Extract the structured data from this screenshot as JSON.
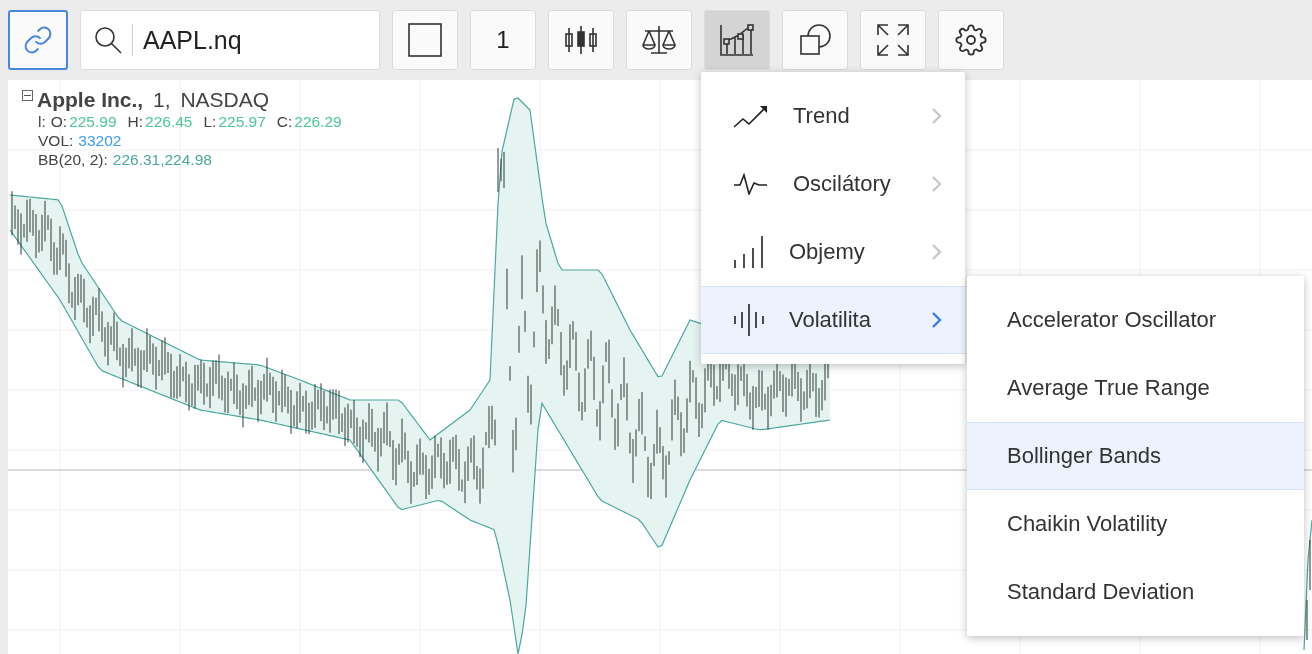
{
  "toolbar": {
    "link_button": {
      "selected": true
    },
    "search": {
      "value": "AAPL.nq"
    },
    "buttons": [
      {
        "kind": "box",
        "selected": false
      },
      {
        "kind": "text",
        "label": "1",
        "selected": false
      },
      {
        "kind": "candles",
        "selected": false
      },
      {
        "kind": "balance",
        "selected": false
      },
      {
        "kind": "indicators",
        "selected": true
      },
      {
        "kind": "shapes",
        "selected": false
      },
      {
        "kind": "fullscreen",
        "selected": false
      },
      {
        "kind": "settings",
        "selected": false
      }
    ]
  },
  "legend": {
    "symbol": "Apple Inc.,",
    "interval": "1,",
    "exchange": "NASDAQ",
    "ohlc_prefix": "l:",
    "ohlc": [
      {
        "label": "O:",
        "value": "225.99"
      },
      {
        "label": "H:",
        "value": "226.45"
      },
      {
        "label": "L:",
        "value": "225.97"
      },
      {
        "label": "C:",
        "value": "226.29"
      }
    ],
    "volume": {
      "label": "VOL:",
      "value": "33202"
    },
    "bollinger": {
      "label": "BB(20, 2):",
      "value": "226.31,224.98"
    }
  },
  "menu": {
    "items": [
      {
        "kind": "trend",
        "label": "Trend",
        "selected": false
      },
      {
        "kind": "oscillator",
        "label": "Oscilátory",
        "selected": false
      },
      {
        "kind": "volume",
        "label": "Objemy",
        "selected": false
      },
      {
        "kind": "volatility",
        "label": "Volatilita",
        "selected": true
      }
    ]
  },
  "submenu": {
    "items": [
      {
        "label": "Accelerator Oscillator",
        "selected": false
      },
      {
        "label": "Average True Range",
        "selected": false
      },
      {
        "label": "Bollinger Bands",
        "selected": true
      },
      {
        "label": "Chaikin Volatility",
        "selected": false
      },
      {
        "label": "Standard Deviation",
        "selected": false
      }
    ]
  }
}
